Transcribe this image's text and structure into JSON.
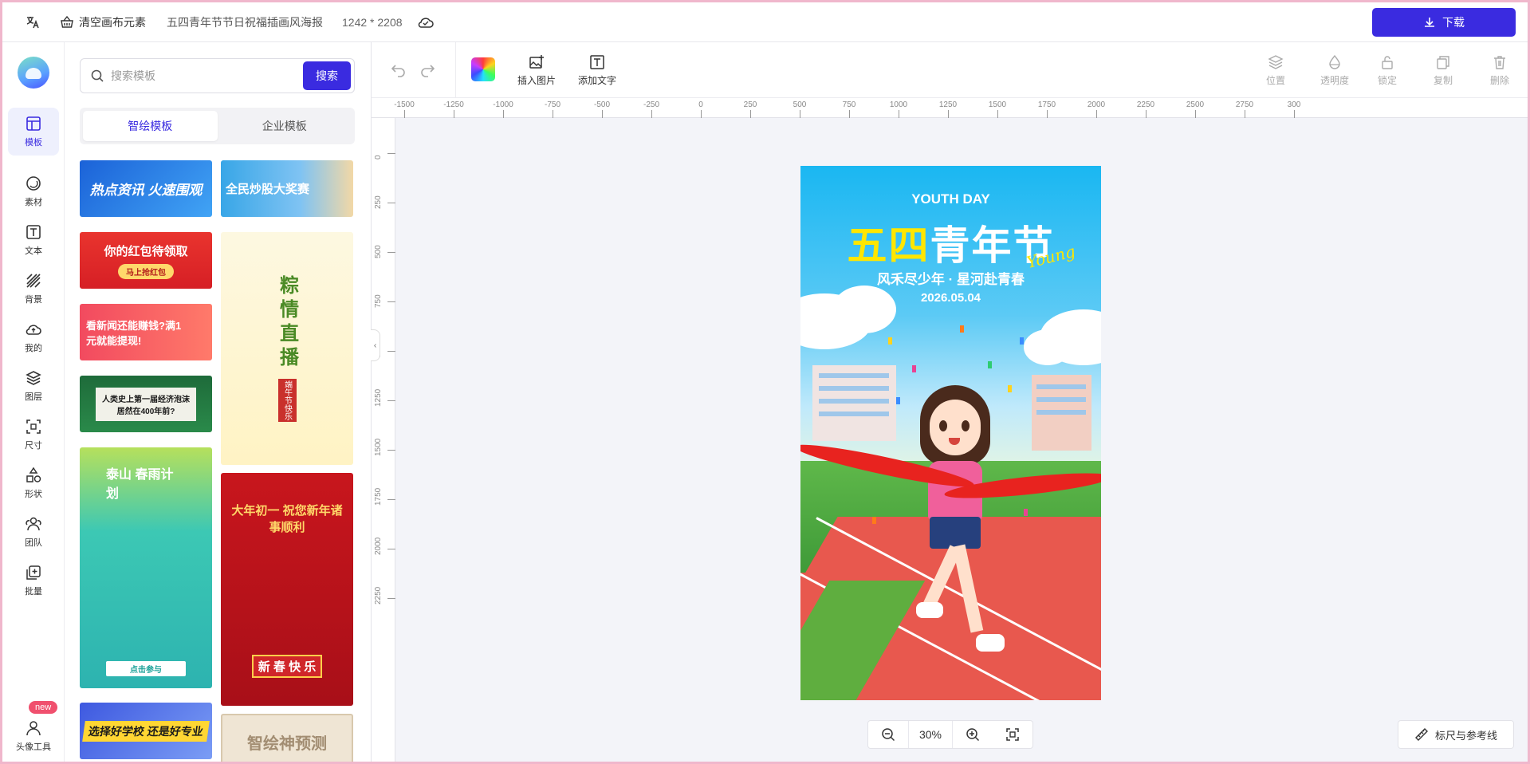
{
  "topbar": {
    "clear_label": "清空画布元素",
    "doc_title": "五四青年节节日祝福插画风海报",
    "doc_size": "1242 * 2208",
    "download_label": "下载"
  },
  "nav": [
    {
      "label": "模板",
      "icon": "layout-icon",
      "active": true
    },
    {
      "label": "素材",
      "icon": "shape-circle-icon"
    },
    {
      "label": "文本",
      "icon": "text-icon"
    },
    {
      "label": "背景",
      "icon": "stripes-icon"
    },
    {
      "label": "我的",
      "icon": "cloud-upload-icon"
    },
    {
      "label": "图层",
      "icon": "layers-icon"
    },
    {
      "label": "尺寸",
      "icon": "resize-icon"
    },
    {
      "label": "形状",
      "icon": "shapes-icon"
    },
    {
      "label": "团队",
      "icon": "team-icon"
    },
    {
      "label": "批量",
      "icon": "batch-icon"
    },
    {
      "label": "头像工具",
      "icon": "user-icon"
    }
  ],
  "new_badge": "new",
  "panel": {
    "search_placeholder": "搜索模板",
    "search_button": "搜索",
    "tabs": [
      "智绘模板",
      "企业模板"
    ],
    "cards": [
      {
        "t1": "热点资讯  火速围观",
        "t2": ""
      },
      {
        "t1": "全民炒股大奖赛",
        "t2": ""
      },
      {
        "t1": "你的红包待领取",
        "t2": "马上抢红包"
      },
      {
        "t1": "粽情直播",
        "t2": "端午节快乐"
      },
      {
        "t1": "看新闻还能赚钱?满1元就能提现!",
        "t2": ""
      },
      {
        "t1": "人类史上第一届经济泡沫 居然在400年前?",
        "t2": ""
      },
      {
        "t1": "泰山 春雨计划",
        "t2": "点击参与"
      },
      {
        "t1": "大年初一 祝您新年诸事顺利",
        "t2": "新 春 快 乐"
      },
      {
        "t1": "选择好学校 还是好专业",
        "t2": ""
      },
      {
        "t1": "智绘神预测",
        "t2": ""
      }
    ]
  },
  "toolbar": {
    "insert_image": "插入图片",
    "add_text": "添加文字",
    "position": "位置",
    "opacity": "透明度",
    "lock": "锁定",
    "copy": "复制",
    "delete": "删除"
  },
  "ruler": {
    "h": [
      "-1500",
      "-1250",
      "-1000",
      "-750",
      "-500",
      "-250",
      "0",
      "250",
      "500",
      "750",
      "1000",
      "1250",
      "1500",
      "1750",
      "2000",
      "2250",
      "2500",
      "2750",
      "300"
    ],
    "v": [
      "0",
      "250",
      "500",
      "750",
      "1000",
      "1250",
      "1500",
      "1750",
      "2000",
      "2250"
    ]
  },
  "poster": {
    "youth_day": "YOUTH DAY",
    "title_yellow": "五四",
    "title_white": "青年节",
    "young": "Young",
    "subtitle": "风禾尽少年 · 星河赴青春",
    "date": "2026.05.04"
  },
  "zoom": "30%",
  "ruler_button": "标尺与参考线",
  "colors": {
    "accent": "#3a2be0",
    "frame": "#f0b7cc"
  }
}
